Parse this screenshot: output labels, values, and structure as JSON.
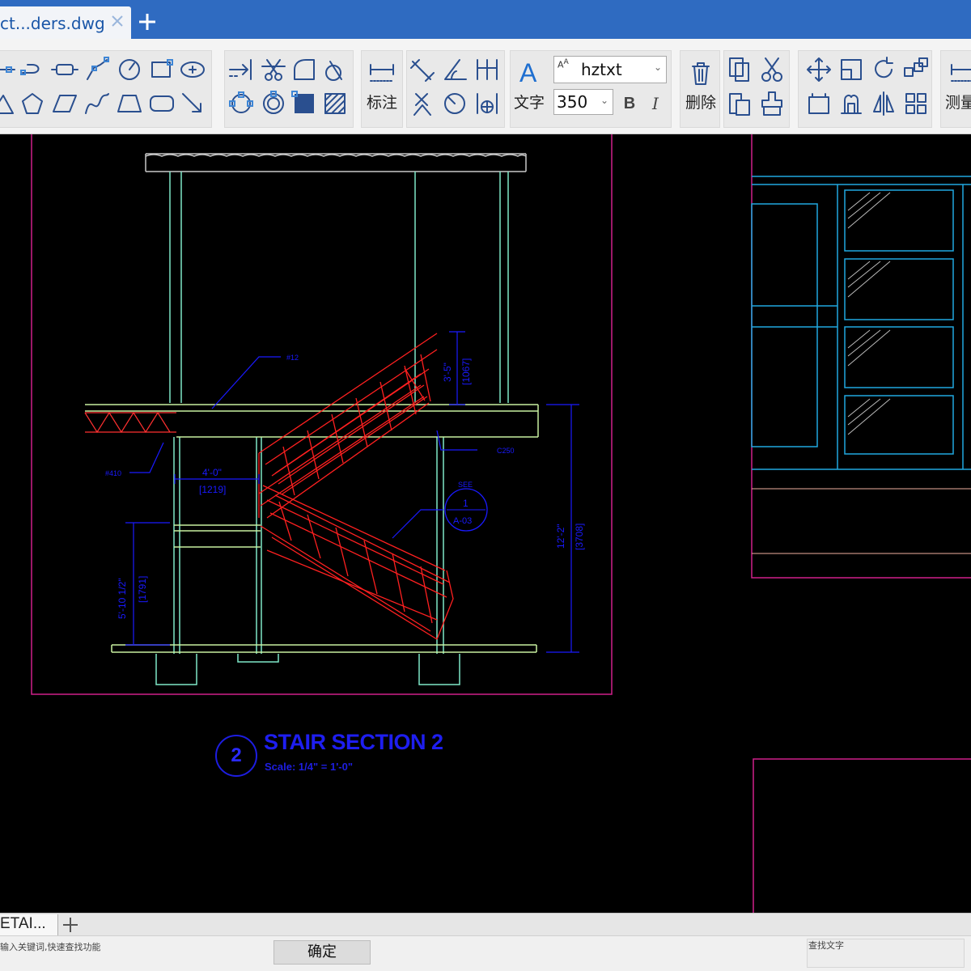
{
  "tabbar": {
    "doc_tab_label": "ct...ders.dwg",
    "close_icon": "close-icon",
    "add_icon": "plus-icon",
    "accent": "#2f6bc1"
  },
  "ribbon": {
    "dimension_label": "标注",
    "text_label": "文字",
    "delete_label": "删除",
    "measure_label": "测量",
    "font_value": "hztxt",
    "height_value": "350",
    "bold_label": "B",
    "italic_label": "I",
    "text_icon_glyph": "A"
  },
  "drawing": {
    "title_number": "2",
    "title_text": "STAIR SECTION 2",
    "scale_text": "Scale: 1/4\" = 1'-0\"",
    "dim_4_0": "4'-0\"",
    "dim_1219": "[1219]",
    "dim_3_5": "3'-5\"",
    "dim_1067": "[1067]",
    "dim_5_10": "5'-10 1/2\"",
    "dim_1791": "[1791]",
    "dim_12_2": "12'-2\"",
    "dim_3708": "[3708]",
    "note_see": "SEE",
    "detail_num": "1",
    "detail_ref": "A-03",
    "label_c250": "C250",
    "label_h10": "#410",
    "label_h12": "#12",
    "colors": {
      "stair": "#ff2020",
      "structure": "#7fe8c8",
      "dimension": "#1a1aff",
      "viewport": "#d0208a",
      "window": "#20a8e0"
    }
  },
  "layout": {
    "tab_label": "ETAI...",
    "add_icon": "plus-icon"
  },
  "status": {
    "search_hint": "输入关键词,快速查找功能",
    "confirm_label": "确定",
    "find_label": "查找文字"
  }
}
